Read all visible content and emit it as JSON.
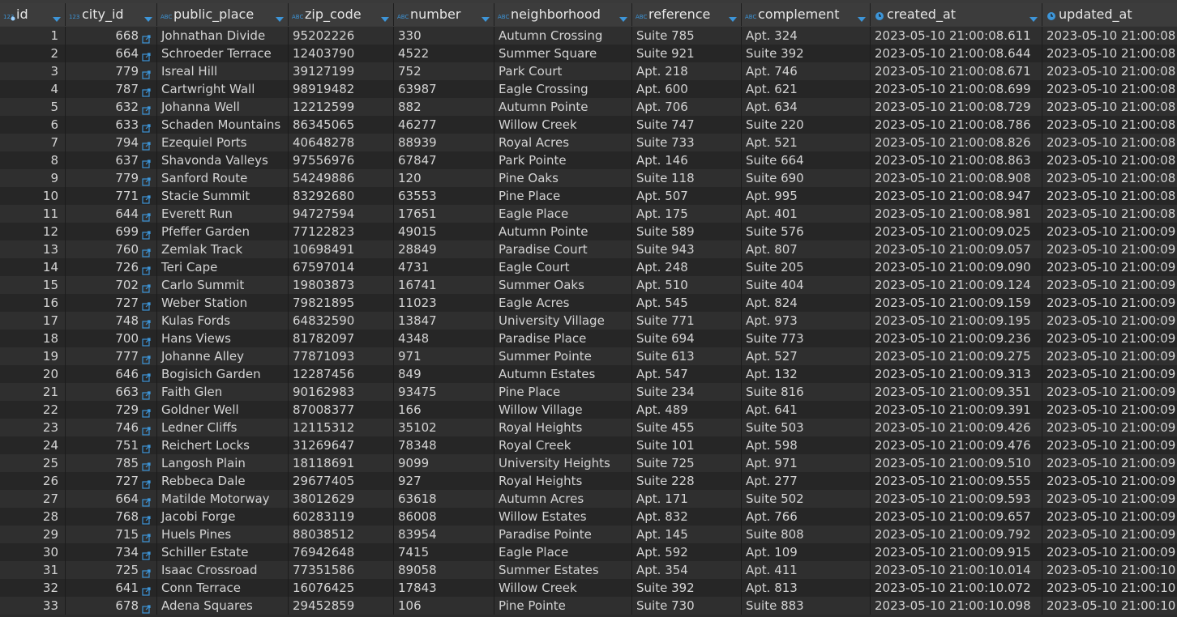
{
  "columns": [
    {
      "name": "id",
      "type_icon": "number-type-icon",
      "key_icon": true
    },
    {
      "name": "city_id",
      "type_icon": "number-type-icon"
    },
    {
      "name": "public_place",
      "type_icon": "text-type-icon"
    },
    {
      "name": "zip_code",
      "type_icon": "text-type-icon"
    },
    {
      "name": "number",
      "type_icon": "text-type-icon"
    },
    {
      "name": "neighborhood",
      "type_icon": "text-type-icon"
    },
    {
      "name": "reference",
      "type_icon": "text-type-icon"
    },
    {
      "name": "complement",
      "type_icon": "text-type-icon"
    },
    {
      "name": "created_at",
      "type_icon": "clock-type-icon"
    },
    {
      "name": "updated_at",
      "type_icon": "clock-type-icon"
    }
  ],
  "type_labels": {
    "number": "123",
    "text": "ABC"
  },
  "colors": {
    "accent": "#3d95d8"
  },
  "rows": [
    [
      "1",
      "668",
      "Johnathan Divide",
      "95202226",
      "330",
      "Autumn Crossing",
      "Suite 785",
      "Apt. 324",
      "2023-05-10 21:00:08.611",
      "2023-05-10 21:00:08"
    ],
    [
      "2",
      "664",
      "Schroeder Terrace",
      "12403790",
      "4522",
      "Summer Square",
      "Suite 921",
      "Suite 392",
      "2023-05-10 21:00:08.644",
      "2023-05-10 21:00:08"
    ],
    [
      "3",
      "779",
      "Isreal Hill",
      "39127199",
      "752",
      "Park Court",
      "Apt. 218",
      "Apt. 746",
      "2023-05-10 21:00:08.671",
      "2023-05-10 21:00:08"
    ],
    [
      "4",
      "787",
      "Cartwright Wall",
      "98919482",
      "63987",
      "Eagle Crossing",
      "Apt. 600",
      "Apt. 621",
      "2023-05-10 21:00:08.699",
      "2023-05-10 21:00:08"
    ],
    [
      "5",
      "632",
      "Johanna Well",
      "12212599",
      "882",
      "Autumn Pointe",
      "Apt. 706",
      "Apt. 634",
      "2023-05-10 21:00:08.729",
      "2023-05-10 21:00:08"
    ],
    [
      "6",
      "633",
      "Schaden Mountains",
      "86345065",
      "46277",
      "Willow Creek",
      "Suite 747",
      "Suite 220",
      "2023-05-10 21:00:08.786",
      "2023-05-10 21:00:08"
    ],
    [
      "7",
      "794",
      "Ezequiel Ports",
      "40648278",
      "88939",
      "Royal Acres",
      "Suite 733",
      "Apt. 521",
      "2023-05-10 21:00:08.826",
      "2023-05-10 21:00:08"
    ],
    [
      "8",
      "637",
      "Shavonda Valleys",
      "97556976",
      "67847",
      "Park Pointe",
      "Apt. 146",
      "Suite 664",
      "2023-05-10 21:00:08.863",
      "2023-05-10 21:00:08"
    ],
    [
      "9",
      "779",
      "Sanford Route",
      "54249886",
      "120",
      "Pine Oaks",
      "Suite 118",
      "Suite 690",
      "2023-05-10 21:00:08.908",
      "2023-05-10 21:00:08"
    ],
    [
      "10",
      "771",
      "Stacie Summit",
      "83292680",
      "63553",
      "Pine Place",
      "Apt. 507",
      "Apt. 995",
      "2023-05-10 21:00:08.947",
      "2023-05-10 21:00:08"
    ],
    [
      "11",
      "644",
      "Everett Run",
      "94727594",
      "17651",
      "Eagle Place",
      "Apt. 175",
      "Apt. 401",
      "2023-05-10 21:00:08.981",
      "2023-05-10 21:00:08"
    ],
    [
      "12",
      "699",
      "Pfeffer Garden",
      "77122823",
      "49015",
      "Autumn Pointe",
      "Suite 589",
      "Suite 576",
      "2023-05-10 21:00:09.025",
      "2023-05-10 21:00:09"
    ],
    [
      "13",
      "760",
      "Zemlak Track",
      "10698491",
      "28849",
      "Paradise Court",
      "Suite 943",
      "Apt. 807",
      "2023-05-10 21:00:09.057",
      "2023-05-10 21:00:09"
    ],
    [
      "14",
      "726",
      "Teri Cape",
      "67597014",
      "4731",
      "Eagle Court",
      "Apt. 248",
      "Suite 205",
      "2023-05-10 21:00:09.090",
      "2023-05-10 21:00:09"
    ],
    [
      "15",
      "702",
      "Carlo Summit",
      "19803873",
      "16741",
      "Summer Oaks",
      "Apt. 510",
      "Suite 404",
      "2023-05-10 21:00:09.124",
      "2023-05-10 21:00:09"
    ],
    [
      "16",
      "727",
      "Weber Station",
      "79821895",
      "11023",
      "Eagle Acres",
      "Apt. 545",
      "Apt. 824",
      "2023-05-10 21:00:09.159",
      "2023-05-10 21:00:09"
    ],
    [
      "17",
      "748",
      "Kulas Fords",
      "64832590",
      "13847",
      "University Village",
      "Suite 771",
      "Apt. 973",
      "2023-05-10 21:00:09.195",
      "2023-05-10 21:00:09"
    ],
    [
      "18",
      "700",
      "Hans Views",
      "81782097",
      "4348",
      "Paradise Place",
      "Suite 694",
      "Suite 773",
      "2023-05-10 21:00:09.236",
      "2023-05-10 21:00:09"
    ],
    [
      "19",
      "777",
      "Johanne Alley",
      "77871093",
      "971",
      "Summer Pointe",
      "Suite 613",
      "Apt. 527",
      "2023-05-10 21:00:09.275",
      "2023-05-10 21:00:09"
    ],
    [
      "20",
      "646",
      "Bogisich Garden",
      "12287456",
      "849",
      "Autumn Estates",
      "Apt. 547",
      "Apt. 132",
      "2023-05-10 21:00:09.313",
      "2023-05-10 21:00:09"
    ],
    [
      "21",
      "663",
      "Faith Glen",
      "90162983",
      "93475",
      "Pine Place",
      "Suite 234",
      "Suite 816",
      "2023-05-10 21:00:09.351",
      "2023-05-10 21:00:09"
    ],
    [
      "22",
      "729",
      "Goldner Well",
      "87008377",
      "166",
      "Willow Village",
      "Apt. 489",
      "Apt. 641",
      "2023-05-10 21:00:09.391",
      "2023-05-10 21:00:09"
    ],
    [
      "23",
      "746",
      "Ledner Cliffs",
      "12115312",
      "35102",
      "Royal Heights",
      "Suite 455",
      "Suite 503",
      "2023-05-10 21:00:09.426",
      "2023-05-10 21:00:09"
    ],
    [
      "24",
      "751",
      "Reichert Locks",
      "31269647",
      "78348",
      "Royal Creek",
      "Suite 101",
      "Apt. 598",
      "2023-05-10 21:00:09.476",
      "2023-05-10 21:00:09"
    ],
    [
      "25",
      "785",
      "Langosh Plain",
      "18118691",
      "9099",
      "University Heights",
      "Suite 725",
      "Apt. 971",
      "2023-05-10 21:00:09.510",
      "2023-05-10 21:00:09"
    ],
    [
      "26",
      "727",
      "Rebbeca Dale",
      "29677405",
      "927",
      "Royal Heights",
      "Suite 228",
      "Apt. 277",
      "2023-05-10 21:00:09.555",
      "2023-05-10 21:00:09"
    ],
    [
      "27",
      "664",
      "Matilde Motorway",
      "38012629",
      "63618",
      "Autumn Acres",
      "Apt. 171",
      "Suite 502",
      "2023-05-10 21:00:09.593",
      "2023-05-10 21:00:09"
    ],
    [
      "28",
      "768",
      "Jacobi Forge",
      "60283119",
      "86008",
      "Willow Estates",
      "Apt. 832",
      "Apt. 766",
      "2023-05-10 21:00:09.657",
      "2023-05-10 21:00:09"
    ],
    [
      "29",
      "715",
      "Huels Pines",
      "88038512",
      "83954",
      "Paradise Pointe",
      "Apt. 145",
      "Suite 808",
      "2023-05-10 21:00:09.792",
      "2023-05-10 21:00:09"
    ],
    [
      "30",
      "734",
      "Schiller Estate",
      "76942648",
      "7415",
      "Eagle Place",
      "Apt. 592",
      "Apt. 109",
      "2023-05-10 21:00:09.915",
      "2023-05-10 21:00:09"
    ],
    [
      "31",
      "725",
      "Isaac Crossroad",
      "77351586",
      "89058",
      "Summer Estates",
      "Apt. 354",
      "Apt. 411",
      "2023-05-10 21:00:10.014",
      "2023-05-10 21:00:10"
    ],
    [
      "32",
      "641",
      "Conn Terrace",
      "16076425",
      "17843",
      "Willow Creek",
      "Suite 392",
      "Apt. 813",
      "2023-05-10 21:00:10.072",
      "2023-05-10 21:00:10"
    ],
    [
      "33",
      "678",
      "Adena Squares",
      "29452859",
      "106",
      "Pine Pointe",
      "Suite 730",
      "Suite 883",
      "2023-05-10 21:00:10.098",
      "2023-05-10 21:00:10"
    ]
  ]
}
